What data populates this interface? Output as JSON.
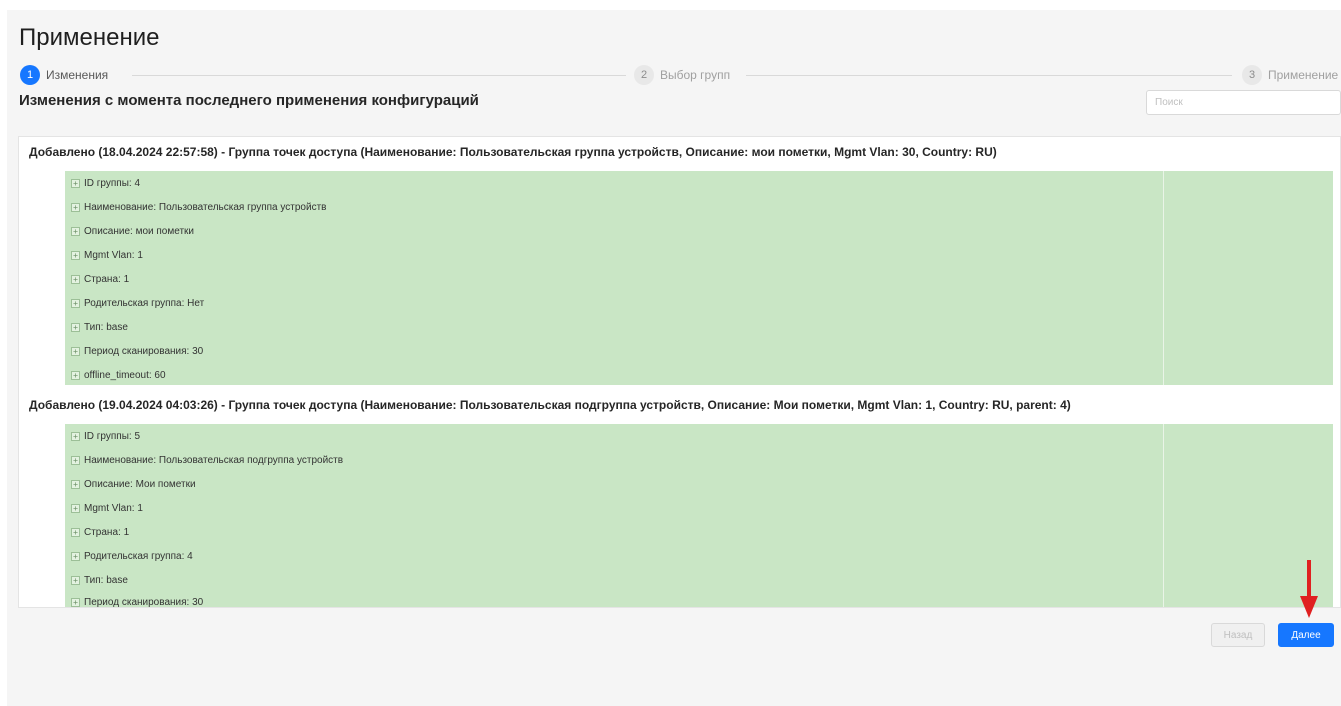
{
  "page": {
    "title": "Применение",
    "subtitle": "Изменения с момента последнего применения конфигураций",
    "search_placeholder": "Поиск"
  },
  "steps": [
    {
      "number": "1",
      "label": "Изменения",
      "state": "active"
    },
    {
      "number": "2",
      "label": "Выбор групп",
      "state": "inactive"
    },
    {
      "number": "3",
      "label": "Применение",
      "state": "inactive"
    }
  ],
  "changes": [
    {
      "header": "Добавлено (18.04.2024 22:57:58) - Группа точек доступа (Наименование: Пользовательская группа устройств, Описание: мои пометки, Mgmt Vlan: 30, Country: RU)",
      "items": [
        "ID группы: 4",
        "Наименование: Пользовательская группа устройств",
        "Описание: мои пометки",
        "Mgmt Vlan: 1",
        "Страна: 1",
        "Родительская группа: Нет",
        "Тип: base",
        "Период сканирования: 30",
        "offline_timeout: 60"
      ]
    },
    {
      "header": "Добавлено (19.04.2024 04:03:26) - Группа точек доступа (Наименование: Пользовательская подгруппа устройств, Описание: Мои пометки, Mgmt Vlan: 1, Country: RU, parent: 4)",
      "items": [
        "ID группы: 5",
        "Наименование: Пользовательская подгруппа устройств",
        "Описание: Мои пометки",
        "Mgmt Vlan: 1",
        "Страна: 1",
        "Родительская группа: 4",
        "Тип: base",
        "Период сканирования: 30"
      ]
    }
  ],
  "footer": {
    "back_label": "Назад",
    "next_label": "Далее"
  },
  "colors": {
    "accent": "#1677ff",
    "added_background": "#c9e6c5",
    "annotation_arrow": "#e02020"
  },
  "icons": {
    "expand": "plus-square-icon",
    "annotation": "arrow-down-icon"
  }
}
